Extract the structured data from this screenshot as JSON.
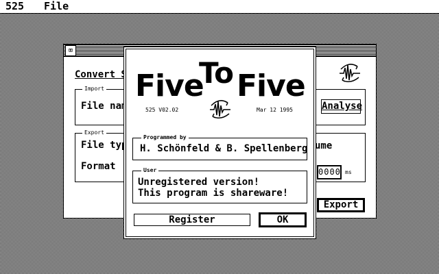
{
  "menubar": {
    "app": "525",
    "file": "File"
  },
  "main_window": {
    "close_glyph": "⌧",
    "title": "Convert S",
    "import_group": {
      "label": "Import",
      "field": "File nam"
    },
    "export_group": {
      "label": "Export",
      "field1": "File typ",
      "field2": "Format"
    },
    "right": {
      "analyse_button": "Analyse",
      "volume_label": "ume",
      "ms_value": "0000",
      "ms_unit": "ms",
      "export_button": "Export"
    },
    "logo_icon": "waveform-arrows-icon"
  },
  "dialog": {
    "title_left": "Five",
    "title_mid": "To",
    "title_right": "Five",
    "version": "525 V02.02",
    "date": "Mar 12 1995",
    "programmed_by": {
      "label": "Programmed by",
      "value": "H. Schönfeld & B. Spellenberg"
    },
    "user": {
      "label": "User",
      "line1": "Unregistered version!",
      "line2": "This program is shareware!"
    },
    "register_button": "Register",
    "ok_button": "OK"
  }
}
